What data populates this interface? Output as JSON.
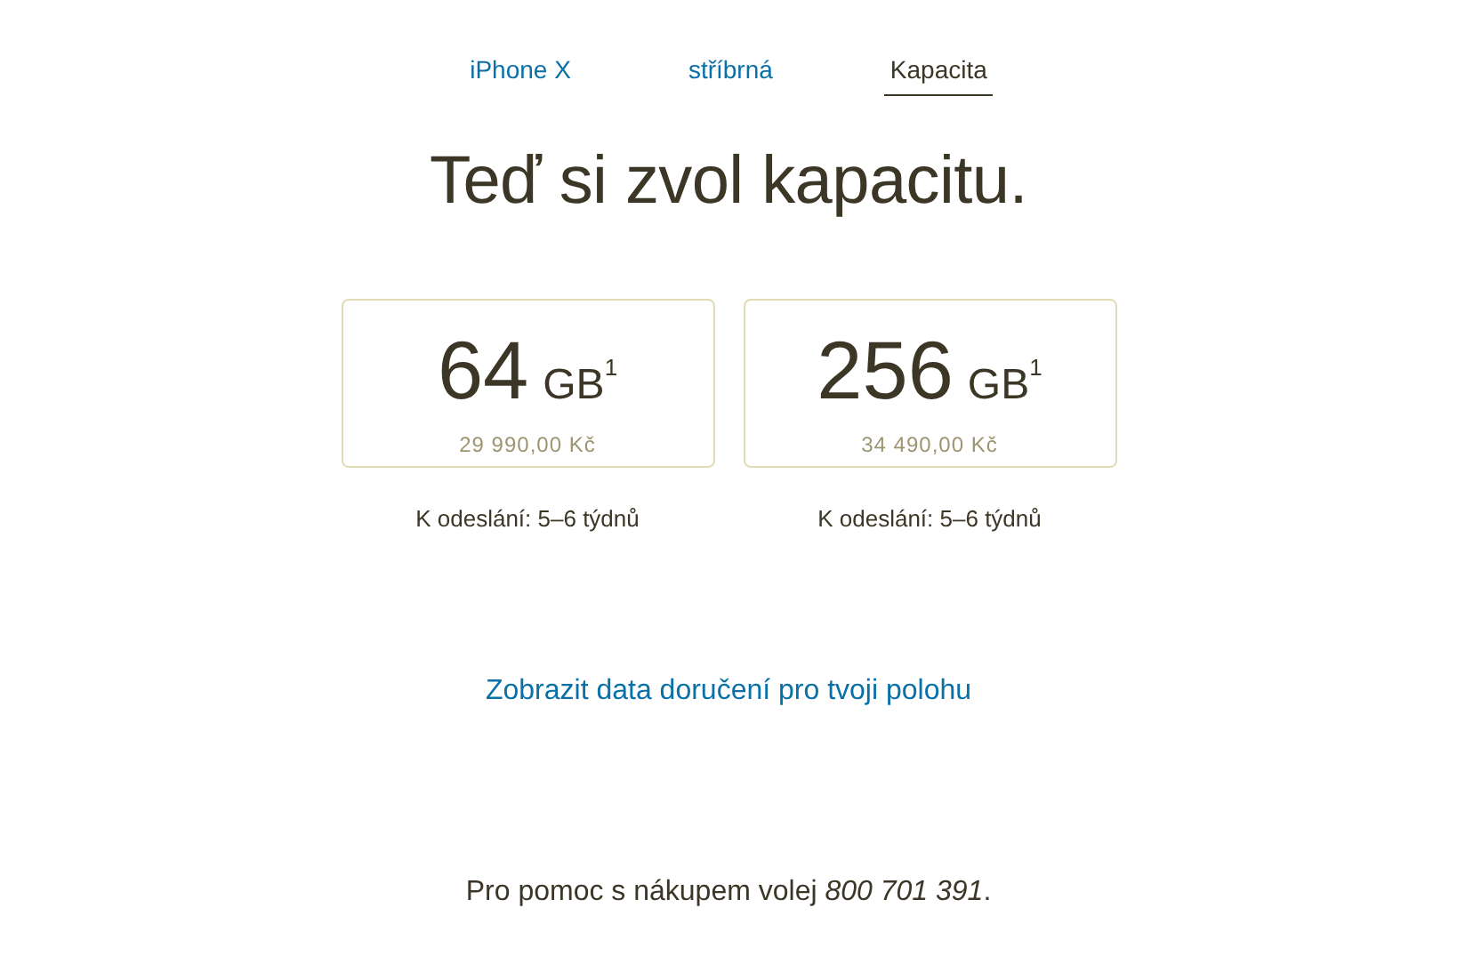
{
  "steps": [
    {
      "label": "iPhone X",
      "selected": false
    },
    {
      "label": "stříbrná",
      "selected": false
    },
    {
      "label": "Kapacita",
      "selected": true
    }
  ],
  "heading": "Teď si zvol kapacitu.",
  "options": [
    {
      "size": "64",
      "unit": "GB$^{1}$",
      "price": "29 990,00 Kč",
      "shipping": "K odeslání: 5–6 týdnů"
    },
    {
      "size": "256",
      "unit": "GB$^{1}$",
      "price": "34 490,00 Kč",
      "shipping": "K odeslání: 5–6 týdnů"
    }
  ],
  "delivery_link": "Zobrazit data doručení pro tvoji polohu",
  "help": "Pro pomoc s nákupem volej *800 701 391*."
}
